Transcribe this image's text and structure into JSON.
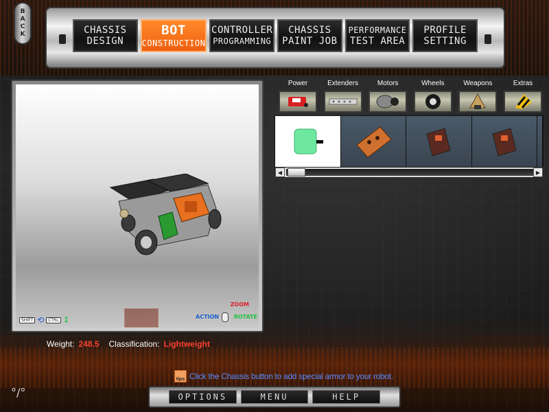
{
  "back": {
    "label": "BACK"
  },
  "tabs": [
    {
      "line1": "CHASSIS",
      "line2": "DESIGN",
      "active": false
    },
    {
      "line1": "BOT",
      "line2": "CONSTRUCTION",
      "active": true
    },
    {
      "line1": "CONTROLLER",
      "line2": "PROGRAMMING",
      "active": false
    },
    {
      "line1": "CHASSIS",
      "line2": "PAINT JOB",
      "active": false
    },
    {
      "line1": "PERFORMANCE",
      "line2": "TEST AREA",
      "active": false
    },
    {
      "line1": "PROFILE",
      "line2": "SETTING",
      "active": false
    }
  ],
  "categories": [
    {
      "label": "Power",
      "icon": "battery-icon"
    },
    {
      "label": "Extenders",
      "icon": "extender-bar-icon"
    },
    {
      "label": "Motors",
      "icon": "motor-icon"
    },
    {
      "label": "Wheels",
      "icon": "wheel-icon"
    },
    {
      "label": "Weapons",
      "icon": "weapon-spike-icon"
    },
    {
      "label": "Extras",
      "icon": "extras-hazard-icon"
    }
  ],
  "viewport_hud": {
    "shift_key": "SHIFT",
    "ctrl_key": "CTRL",
    "zoom": "ZOOM",
    "action": "ACTION",
    "rotate": "ROTATE"
  },
  "stats": {
    "weight_label": "Weight:",
    "weight_value": "248.5",
    "class_label": "Classification:",
    "class_value": "Lightweight"
  },
  "tip": {
    "icon_text": "tips",
    "text": "Click the Chassis button to add special armor to your robot."
  },
  "bottom_menu": [
    "OPTIONS",
    "MENU",
    "HELP"
  ],
  "colors": {
    "accent_orange": "#f06010",
    "weight_red": "#ff4030",
    "tip_blue": "#5a8aff"
  }
}
